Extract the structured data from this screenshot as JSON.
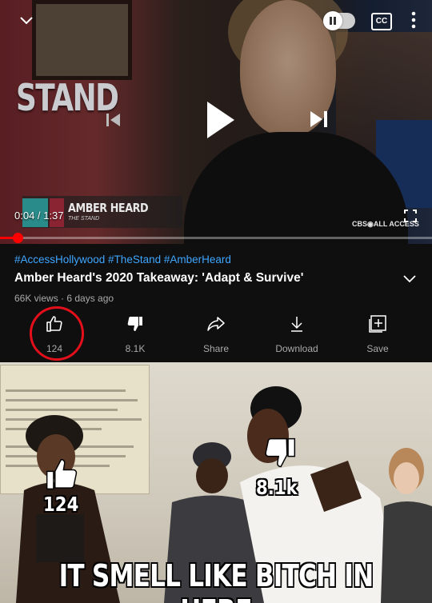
{
  "player": {
    "show_logo": "STAND",
    "time": "0:04 / 1:37",
    "cc_label": "CC",
    "name_card": {
      "name": "AMBER HEARD",
      "sub": "THE STAND"
    },
    "network": "CBS◉ALL ACCESS",
    "progress": 0.041
  },
  "video": {
    "hashtags": "#AccessHollywood #TheStand #AmberHeard",
    "title": "Amber Heard's 2020 Takeaway: 'Adapt & Survive'",
    "meta": "66K views · 6 days ago"
  },
  "actions": {
    "like": "124",
    "dislike": "8.1K",
    "share": "Share",
    "download": "Download",
    "save": "Save"
  },
  "meme": {
    "like_count": "124",
    "dislike_count": "8.1k",
    "caption": "IT SMELL LIKE BITCH IN HERE"
  },
  "colors": {
    "accent_red": "#ff0000",
    "link_blue": "#3ea6ff",
    "circle_red": "#e3101b"
  }
}
